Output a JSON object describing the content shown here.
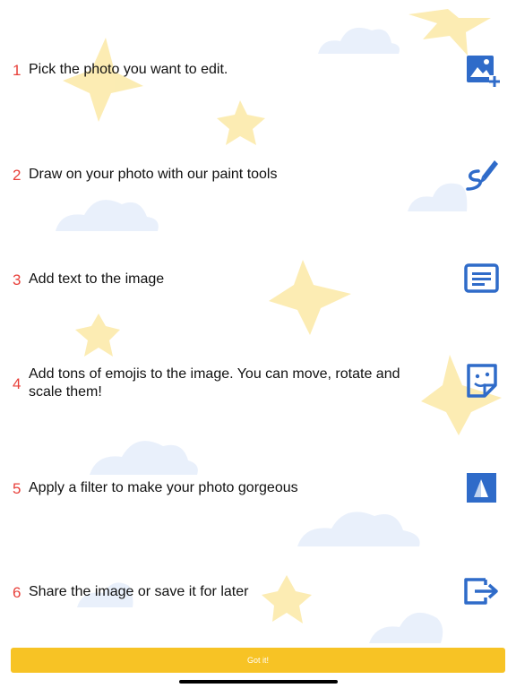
{
  "colors": {
    "number": "#e8403a",
    "icon": "#2f6bc9",
    "button": "#f7c325",
    "star": "#fbe7a0",
    "cloud": "#e6eefb"
  },
  "steps": [
    {
      "number": "1",
      "text": "Pick the photo you want to edit.",
      "icon": "add-photo-icon"
    },
    {
      "number": "2",
      "text": "Draw on your photo with our paint tools",
      "icon": "paint-brush-icon"
    },
    {
      "number": "3",
      "text": "Add text to the image",
      "icon": "text-box-icon"
    },
    {
      "number": "4",
      "text": "Add tons of emojis to the image. You can move, rotate and scale them!",
      "icon": "sticker-icon"
    },
    {
      "number": "5",
      "text": "Apply a filter to make your photo gorgeous",
      "icon": "filter-icon"
    },
    {
      "number": "6",
      "text": "Share the image or save it for later",
      "icon": "share-exit-icon"
    }
  ],
  "button": {
    "label": "Got it!"
  }
}
